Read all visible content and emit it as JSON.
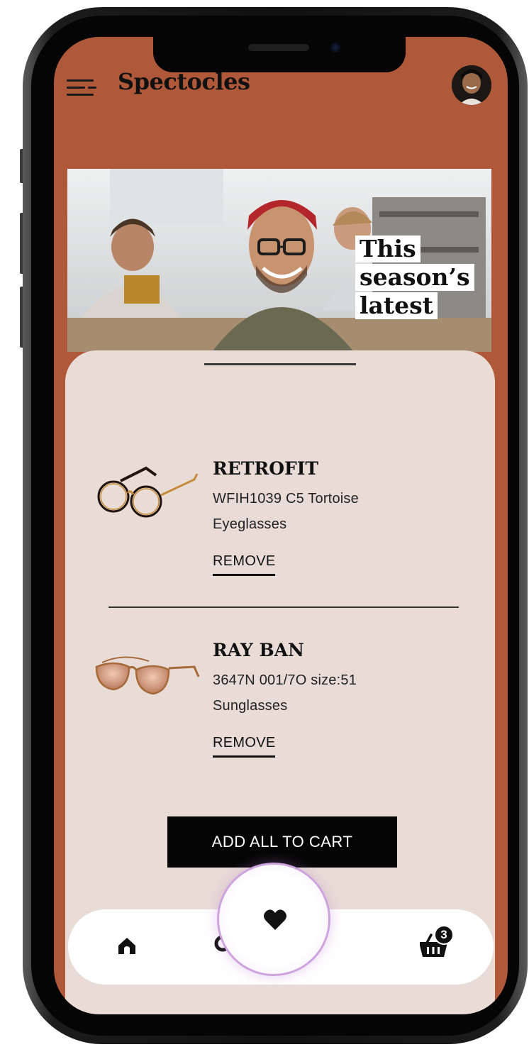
{
  "header": {
    "title": "Spectocles"
  },
  "hero": {
    "caption_lines": [
      "This",
      "season’s",
      "latest"
    ]
  },
  "wishlist": {
    "items": [
      {
        "name": "RETROFIT",
        "model": "WFIH1039 C5 Tortoise",
        "type": "Eyeglasses",
        "remove_label": "REMOVE",
        "thumb_icon": "round-eyeglasses-icon"
      },
      {
        "name": "RAY BAN",
        "model": "3647N 001/7O size:51",
        "type": "Sunglasses",
        "remove_label": "REMOVE",
        "thumb_icon": "aviator-sunglasses-icon"
      }
    ],
    "add_all_label": "ADD ALL TO CART"
  },
  "nav": {
    "tabs": [
      {
        "icon": "home-icon",
        "active": false
      },
      {
        "icon": "search-icon",
        "active": false
      },
      {
        "icon": "heart-icon",
        "active": true
      },
      {
        "icon": "basket-icon",
        "active": false
      }
    ],
    "cart_count": "3"
  },
  "colors": {
    "background": "#b0593a",
    "sheet": "#e9dcd6",
    "button": "#050505",
    "active_ring": "#cda4dd"
  }
}
